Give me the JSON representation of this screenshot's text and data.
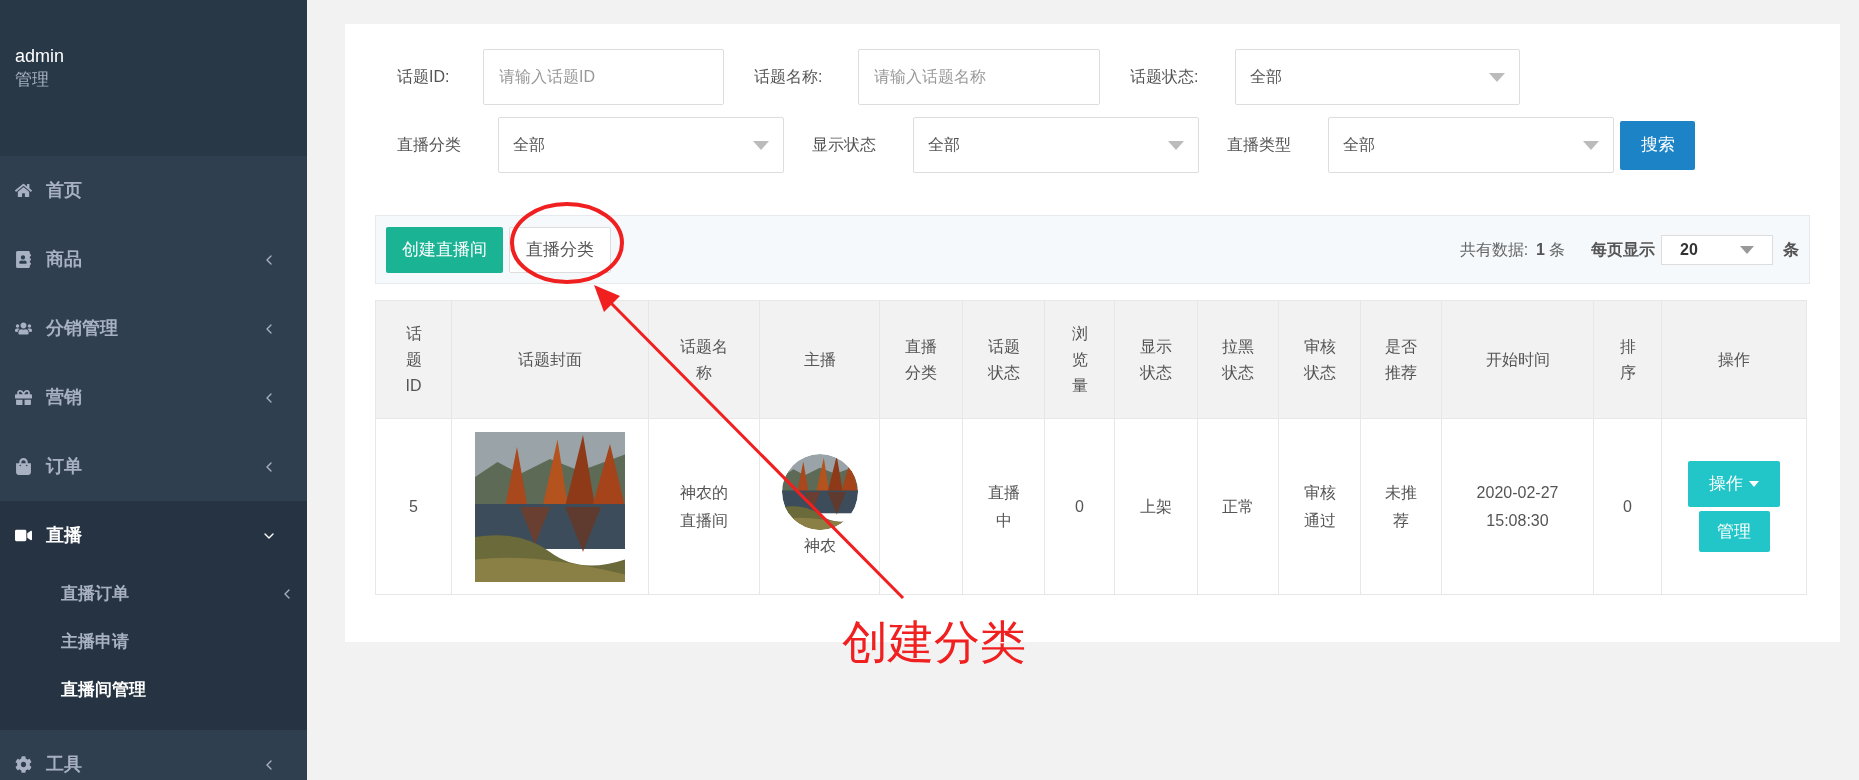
{
  "sidebar": {
    "user": {
      "name": "admin",
      "role": "管理"
    },
    "items": [
      {
        "label": "首页",
        "kind": "link",
        "expanded": false
      },
      {
        "label": "商品",
        "kind": "group",
        "expanded": false
      },
      {
        "label": "分销管理",
        "kind": "group",
        "expanded": false
      },
      {
        "label": "营销",
        "kind": "group",
        "expanded": false
      },
      {
        "label": "订单",
        "kind": "group",
        "expanded": false
      },
      {
        "label": "直播",
        "kind": "group",
        "expanded": true,
        "children": [
          {
            "label": "直播订单",
            "kind": "group",
            "selected": false
          },
          {
            "label": "主播申请",
            "kind": "link",
            "selected": false
          },
          {
            "label": "直播间管理",
            "kind": "link",
            "selected": true
          }
        ]
      },
      {
        "label": "工具",
        "kind": "group",
        "expanded": false
      }
    ]
  },
  "filters": [
    {
      "label": "话题ID:",
      "kind": "text",
      "placeholder": "请输入话题ID"
    },
    {
      "label": "话题名称:",
      "kind": "text",
      "placeholder": "请输入话题名称"
    },
    {
      "label": "话题状态:",
      "kind": "select",
      "value": "全部"
    },
    {
      "label": "直播分类",
      "kind": "select",
      "value": "全部"
    },
    {
      "label": "显示状态",
      "kind": "select",
      "value": "全部"
    },
    {
      "label": "直播类型",
      "kind": "select",
      "value": "全部"
    }
  ],
  "search_button": "搜索",
  "toolbar": {
    "buttons": [
      {
        "label": "创建直播间",
        "kind": "primary"
      },
      {
        "label": "直播分类",
        "kind": "default"
      }
    ],
    "total": {
      "label": "共有数据:",
      "count": "1",
      "unit": "条"
    },
    "page_size": {
      "label": "每页显示",
      "value": "20",
      "unit": "条"
    }
  },
  "table": {
    "columns": [
      "话题ID",
      "话题封面",
      "话题名称",
      "主播",
      "直播分类",
      "话题状态",
      "浏览量",
      "显示状态",
      "拉黑状态",
      "审核状态",
      "是否推荐",
      "开始时间",
      "排序",
      "操作"
    ],
    "rows": [
      {
        "cells": [
          {
            "kind": "text",
            "text": "5"
          },
          {
            "kind": "picture"
          },
          {
            "kind": "text",
            "text": "神农的直播间"
          },
          {
            "kind": "anchor",
            "text": "神农"
          },
          {
            "kind": "empty"
          },
          {
            "kind": "text",
            "text": "直播中"
          },
          {
            "kind": "text",
            "text": "0"
          },
          {
            "kind": "text",
            "text": "上架"
          },
          {
            "kind": "text",
            "text": "正常"
          },
          {
            "kind": "text",
            "text": "审核通过"
          },
          {
            "kind": "text",
            "text": "未推荐"
          },
          {
            "kind": "text",
            "text": "2020-02-27 15:08:30"
          },
          {
            "kind": "text",
            "text": "0"
          },
          {
            "kind": "actions",
            "buttons": [
              {
                "label": "操作",
                "dropdown": true
              },
              {
                "label": "管理",
                "dropdown": false
              }
            ]
          }
        ]
      }
    ]
  },
  "annotation": {
    "text": "创建分类"
  }
}
